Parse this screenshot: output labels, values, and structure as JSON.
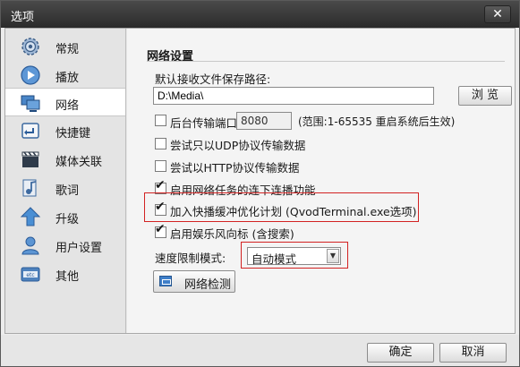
{
  "window": {
    "title": "选项",
    "close_label": "✕"
  },
  "sidebar": {
    "items": [
      {
        "label": "常规",
        "icon": "gear-icon",
        "active": false
      },
      {
        "label": "播放",
        "icon": "play-icon",
        "active": false
      },
      {
        "label": "网络",
        "icon": "network-icon",
        "active": true
      },
      {
        "label": "快捷键",
        "icon": "keyboard-icon",
        "active": false
      },
      {
        "label": "媒体关联",
        "icon": "clapperboard-icon",
        "active": false
      },
      {
        "label": "歌词",
        "icon": "music-note-icon",
        "active": false
      },
      {
        "label": "升级",
        "icon": "upgrade-arrow-icon",
        "active": false
      },
      {
        "label": "用户设置",
        "icon": "user-icon",
        "active": false
      },
      {
        "label": "其他",
        "icon": "etc-icon",
        "active": false
      }
    ]
  },
  "main": {
    "section_title": "网络设置",
    "save_path": {
      "label": "默认接收文件保存路径:",
      "value": "D:\\Media\\"
    },
    "browse_label": "浏 览",
    "background_port": {
      "label": "后台传输端口",
      "value": "8080",
      "hint": "(范围:1-65535 重启系统后生效)",
      "checked": false
    },
    "options": [
      {
        "label": "尝试只以UDP协议传输数据",
        "checked": false
      },
      {
        "label": "尝试以HTTP协议传输数据",
        "checked": false
      },
      {
        "label": "启用网络任务的连下连播功能",
        "checked": true
      },
      {
        "label": "加入快播缓冲优化计划 (QvodTerminal.exe选项)",
        "checked": true,
        "highlighted": true
      },
      {
        "label": "启用娱乐风向标 (含搜索)",
        "checked": true
      }
    ],
    "speed_limit": {
      "label": "速度限制模式:",
      "value": "自动模式",
      "highlighted": true
    },
    "net_check_label": "网络检测"
  },
  "footer": {
    "ok_label": "确定",
    "cancel_label": "取消"
  },
  "colors": {
    "titlebar": "#333333",
    "highlight_border": "#d22222",
    "check_blue": "#3f7fc9"
  }
}
